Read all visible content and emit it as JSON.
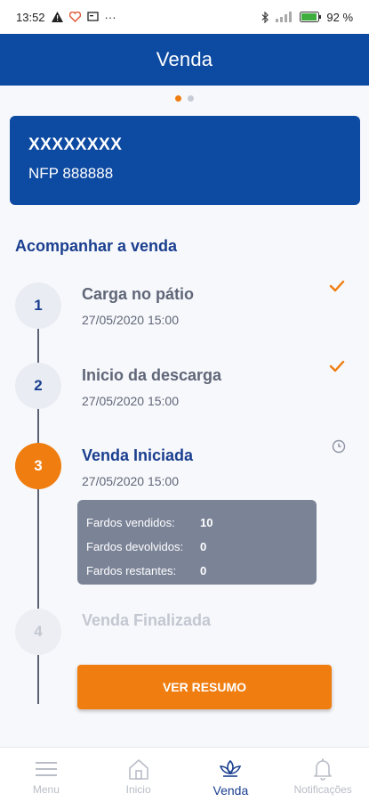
{
  "status_bar": {
    "time": "13:52",
    "extra": "···",
    "battery": "92"
  },
  "header": {
    "title": "Venda"
  },
  "card": {
    "title": "XXXXXXXX",
    "subtitle": "NFP 888888"
  },
  "section": {
    "title": "Acompanhar a venda"
  },
  "steps": [
    {
      "number": "1",
      "title": "Carga no pátio",
      "date": "27/05/2020 15:00",
      "state": "done"
    },
    {
      "number": "2",
      "title": "Inicio da descarga",
      "date": "27/05/2020 15:00",
      "state": "done"
    },
    {
      "number": "3",
      "title": "Venda Iniciada",
      "date": "27/05/2020 15:00",
      "state": "current"
    },
    {
      "number": "4",
      "title": "Venda Finalizada",
      "date": "",
      "state": "pending"
    }
  ],
  "summary": {
    "rows": [
      {
        "label": "Fardos vendidos:",
        "value": "10"
      },
      {
        "label": "Fardos devolvidos:",
        "value": "0"
      },
      {
        "label": "Fardos restantes:",
        "value": "0"
      }
    ]
  },
  "cta": {
    "label": "VER RESUMO"
  },
  "nav": {
    "items": [
      {
        "label": "Menu",
        "icon": "menu-icon"
      },
      {
        "label": "Inicio",
        "icon": "home-icon"
      },
      {
        "label": "Venda",
        "icon": "leaf-icon"
      },
      {
        "label": "Notificações",
        "icon": "bell-icon"
      }
    ],
    "active": "Venda"
  },
  "colors": {
    "primary": "#0d4aa2",
    "accent": "#ef7d10",
    "title_blue": "#1a3f8f",
    "muted": "#5f6678"
  }
}
